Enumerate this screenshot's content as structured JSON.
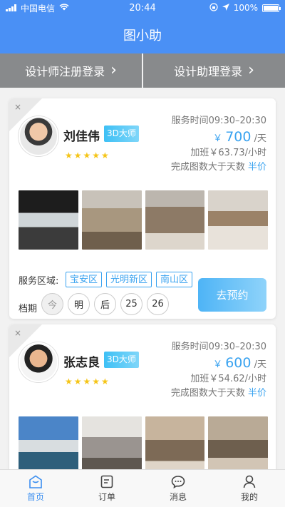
{
  "status": {
    "carrier": "中国电信",
    "time": "20:44",
    "battery": "100%",
    "battery_level": 1.0
  },
  "header": {
    "title": "图小助"
  },
  "login": {
    "designer": "设计师注册登录",
    "assistant": "设计助理登录",
    "chevron": "›"
  },
  "labels": {
    "service_area": "服务区域:",
    "schedule": "档期",
    "book": "去预约",
    "badge": "3D大师",
    "per_day": "/天",
    "half": "半价",
    "close": "×",
    "yen": "￥",
    "stars": "★★★★★"
  },
  "cards": [
    {
      "name": "刘佳伟",
      "service_time": "服务时间09:30–20:30",
      "price": "700",
      "overtime": "加班￥63.73/小时",
      "discount": "完成图数大于天数",
      "rating": 5,
      "areas": [
        "宝安区",
        "光明新区",
        "南山区"
      ],
      "days": [
        "今",
        "明",
        "后",
        "25",
        "26"
      ]
    },
    {
      "name": "张志良",
      "service_time": "服务时间09:30–20:30",
      "price": "600",
      "overtime": "加班￥54.62/小时",
      "discount": "完成图数大于天数",
      "rating": 5
    }
  ],
  "tabs": [
    {
      "label": "首页",
      "icon": "home-icon",
      "active": true
    },
    {
      "label": "订单",
      "icon": "order-icon",
      "active": false
    },
    {
      "label": "消息",
      "icon": "message-icon",
      "active": false
    },
    {
      "label": "我的",
      "icon": "user-icon",
      "active": false
    }
  ],
  "colors": {
    "primary": "#4a90f5",
    "accent": "#3aa3f0",
    "star": "#f5c518",
    "login_bar": "#888a8c"
  }
}
